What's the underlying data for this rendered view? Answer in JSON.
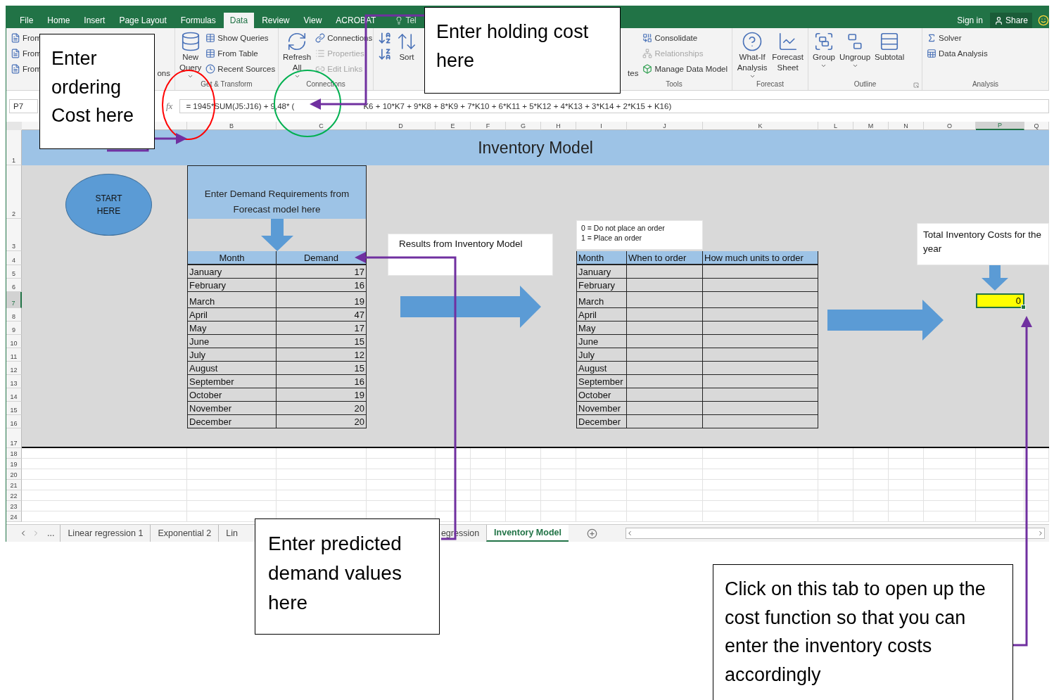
{
  "ribbon_tabs": [
    {
      "label": "File",
      "selected": false
    },
    {
      "label": "Home",
      "selected": false
    },
    {
      "label": "Insert",
      "selected": false
    },
    {
      "label": "Page Layout",
      "selected": false
    },
    {
      "label": "Formulas",
      "selected": false
    },
    {
      "label": "Data",
      "selected": true
    },
    {
      "label": "Review",
      "selected": false
    },
    {
      "label": "View",
      "selected": false
    },
    {
      "label": "ACROBAT",
      "selected": false
    }
  ],
  "tell_me": "Tel",
  "account": {
    "sign_in": "Sign in",
    "share": "Share"
  },
  "ribbon_groups": [
    {
      "items": [
        {
          "kind": "small",
          "label": "From",
          "disabled": false
        },
        {
          "kind": "small",
          "label": "From",
          "disabled": false
        },
        {
          "kind": "small",
          "label": "From",
          "disabled": false
        },
        {
          "kind": "fragment",
          "label": "ons"
        }
      ]
    },
    {
      "label": "Get & Transform",
      "items": [
        {
          "kind": "large",
          "label": "New Query",
          "dropdown": true
        },
        {
          "kind": "small",
          "label": "Show Queries",
          "disabled": false
        },
        {
          "kind": "small",
          "label": "From Table",
          "disabled": false
        },
        {
          "kind": "small",
          "label": "Recent Sources",
          "disabled": false
        }
      ]
    },
    {
      "label": "Connections",
      "items": [
        {
          "kind": "large",
          "label": "Refresh All",
          "dropdown": true
        },
        {
          "kind": "small",
          "label": "Connections",
          "disabled": false
        },
        {
          "kind": "small",
          "label": "Properties",
          "disabled": true
        },
        {
          "kind": "small",
          "label": "Edit Links",
          "disabled": true
        }
      ]
    },
    {
      "items": [
        {
          "kind": "icon_stack"
        },
        {
          "kind": "large",
          "label": "Sort",
          "dropdown": false
        }
      ]
    },
    {
      "label": "Tools",
      "items": [
        {
          "kind": "fragment",
          "label": "tes"
        },
        {
          "kind": "small",
          "label": "Consolidate",
          "disabled": false
        },
        {
          "kind": "small",
          "label": "Relationships",
          "disabled": true
        },
        {
          "kind": "small",
          "label": "Manage Data Model",
          "disabled": false
        }
      ]
    },
    {
      "label": "Forecast",
      "items": [
        {
          "kind": "large",
          "label": "What-If Analysis",
          "dropdown": true
        },
        {
          "kind": "large",
          "label": "Forecast Sheet",
          "dropdown": false
        }
      ]
    },
    {
      "label": "Outline",
      "items": [
        {
          "kind": "large",
          "label": "Group",
          "dropdown": true
        },
        {
          "kind": "large",
          "label": "Ungroup",
          "dropdown": true
        },
        {
          "kind": "large",
          "label": "Subtotal",
          "dropdown": false
        }
      ]
    },
    {
      "label": "Analysis",
      "items": [
        {
          "kind": "small",
          "label": "Solver",
          "disabled": false
        },
        {
          "kind": "small",
          "label": "Data Analysis",
          "disabled": false
        }
      ]
    }
  ],
  "formula_bar": {
    "name_box": "P7",
    "fx": "fx",
    "formula_parts": [
      "= 1945*SUM(J5:J16) + 9,48* (",
      "K6 + 10*K7 + 9*K8 + 8*K9 + 7*K10 + 6*K11 + 5*K12 + 4*K13 + 3*K14 + 2*K15 + K16)"
    ]
  },
  "columns": [
    {
      "label": "B",
      "selected": false
    },
    {
      "label": "C",
      "selected": false
    },
    {
      "label": "D",
      "selected": false
    },
    {
      "label": "E",
      "selected": false
    },
    {
      "label": "F",
      "selected": false
    },
    {
      "label": "G",
      "selected": false
    },
    {
      "label": "H",
      "selected": false
    },
    {
      "label": "I",
      "selected": false
    },
    {
      "label": "J",
      "selected": false
    },
    {
      "label": "K",
      "selected": false
    },
    {
      "label": "L",
      "selected": false
    },
    {
      "label": "M",
      "selected": false
    },
    {
      "label": "N",
      "selected": false
    },
    {
      "label": "O",
      "selected": false
    },
    {
      "label": "P",
      "selected": true
    },
    {
      "label": "Q",
      "selected": false
    }
  ],
  "rows": [
    {
      "label": "1",
      "selected": false
    },
    {
      "label": "2",
      "selected": false
    },
    {
      "label": "3",
      "selected": false
    },
    {
      "label": "4",
      "selected": false
    },
    {
      "label": "5",
      "selected": false
    },
    {
      "label": "6",
      "selected": false
    },
    {
      "label": "7",
      "selected": true
    },
    {
      "label": "8",
      "selected": false
    },
    {
      "label": "9",
      "selected": false
    },
    {
      "label": "10",
      "selected": false
    },
    {
      "label": "11",
      "selected": false
    },
    {
      "label": "12",
      "selected": false
    },
    {
      "label": "13",
      "selected": false
    },
    {
      "label": "14",
      "selected": false
    },
    {
      "label": "15",
      "selected": false
    },
    {
      "label": "16",
      "selected": false
    },
    {
      "label": "17",
      "selected": false
    },
    {
      "label": "18",
      "selected": false
    },
    {
      "label": "19",
      "selected": false
    },
    {
      "label": "20",
      "selected": false
    },
    {
      "label": "21",
      "selected": false
    },
    {
      "label": "22",
      "selected": false
    },
    {
      "label": "23",
      "selected": false
    },
    {
      "label": "24",
      "selected": false
    }
  ],
  "title": "Inventory Model",
  "start_button": "START HERE",
  "demand_table": {
    "caption": "Enter Demand Requirements from Forecast model here",
    "columns": [
      "Month",
      "Demand"
    ],
    "rows": [
      [
        "January",
        "17"
      ],
      [
        "February",
        "16"
      ],
      [
        "March",
        "19"
      ],
      [
        "April",
        "47"
      ],
      [
        "May",
        "17"
      ],
      [
        "June",
        "15"
      ],
      [
        "July",
        "12"
      ],
      [
        "August",
        "15"
      ],
      [
        "September",
        "16"
      ],
      [
        "October",
        "19"
      ],
      [
        "November",
        "20"
      ],
      [
        "December",
        "20"
      ]
    ]
  },
  "results_label": "Results from Inventory Model",
  "order_legend": [
    "0 = Do not place an order",
    "1 = Place an order"
  ],
  "order_table": {
    "columns": [
      "Month",
      "When to order",
      "How much units to order"
    ],
    "months": [
      "January",
      "February",
      "March",
      "April",
      "May",
      "June",
      "July",
      "August",
      "September",
      "October",
      "November",
      "December"
    ]
  },
  "total": {
    "label": "Total Inventory Costs for the year",
    "value": "0",
    "selected": true
  },
  "sheet_nav": "...",
  "sheet_tabs": [
    {
      "label": "Linear regression 1",
      "selected": false
    },
    {
      "label": "Exponential 2",
      "selected": false
    },
    {
      "label": "Lin",
      "selected": false
    },
    {
      "label": "egression",
      "selected": false
    },
    {
      "label": "Inventory Model",
      "selected": true
    }
  ],
  "callouts": [
    {
      "text": "Enter ordering Cost here"
    },
    {
      "text": "Enter holding cost here"
    },
    {
      "text": "Enter predicted demand values here"
    },
    {
      "text": "Click on this tab to open up the cost function so that you can enter the inventory costs accordingly"
    }
  ]
}
